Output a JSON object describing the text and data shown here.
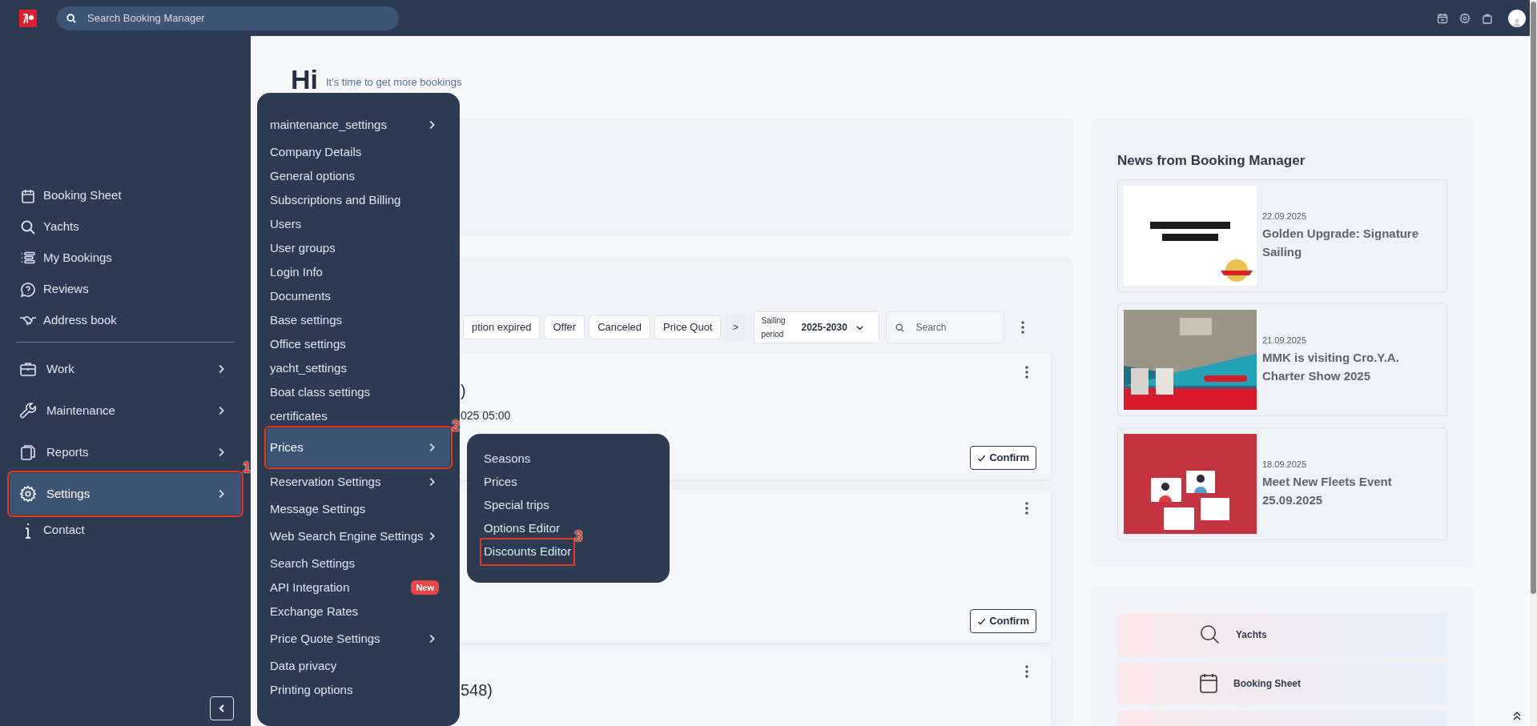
{
  "topbar": {
    "search_placeholder": "Search Booking Manager"
  },
  "sidebar": {
    "sections": [
      {
        "items": [
          {
            "label": "Booking Sheet",
            "has_submenu": false,
            "selected": false
          },
          {
            "label": "Yachts",
            "has_submenu": false,
            "selected": false
          },
          {
            "label": "My Bookings",
            "has_submenu": false,
            "selected": false
          },
          {
            "label": "Reviews",
            "has_submenu": false,
            "selected": false
          },
          {
            "label": "Address book",
            "has_submenu": false,
            "selected": false
          }
        ]
      },
      {
        "items": [
          {
            "label": "Work",
            "has_submenu": true,
            "selected": false
          },
          {
            "label": "Maintenance",
            "has_submenu": true,
            "selected": false
          },
          {
            "label": "Reports",
            "has_submenu": true,
            "selected": false
          },
          {
            "label": "Settings",
            "has_submenu": true,
            "selected": true,
            "annotation": "1"
          },
          {
            "label": "Contact",
            "has_submenu": false,
            "selected": false
          }
        ]
      }
    ]
  },
  "greeting": {
    "title": "Hi",
    "subtitle": "It's time to get more bookings"
  },
  "settings_menu": [
    {
      "label": "maintenance_settings",
      "has_submenu": true,
      "selected": false
    },
    {
      "label": "Company Details",
      "has_submenu": false,
      "selected": false
    },
    {
      "label": "General options",
      "has_submenu": false,
      "selected": false
    },
    {
      "label": "Subscriptions and Billing",
      "has_submenu": false,
      "selected": false
    },
    {
      "label": "Users",
      "has_submenu": false,
      "selected": false
    },
    {
      "label": "User groups",
      "has_submenu": false,
      "selected": false
    },
    {
      "label": "Login Info",
      "has_submenu": false,
      "selected": false
    },
    {
      "label": "Documents",
      "has_submenu": false,
      "selected": false
    },
    {
      "label": "Base settings",
      "has_submenu": false,
      "selected": false
    },
    {
      "label": "Office settings",
      "has_submenu": false,
      "selected": false
    },
    {
      "label": "yacht_settings",
      "has_submenu": false,
      "selected": false
    },
    {
      "label": "Boat class settings",
      "has_submenu": false,
      "selected": false
    },
    {
      "label": "certificates",
      "has_submenu": false,
      "selected": false
    },
    {
      "label": "Prices",
      "has_submenu": true,
      "selected": true,
      "annotation": "2"
    },
    {
      "label": "Reservation Settings",
      "has_submenu": true,
      "selected": false
    },
    {
      "label": "Message Settings",
      "has_submenu": false,
      "selected": false
    },
    {
      "label": "Web Search Engine Settings",
      "has_submenu": true,
      "selected": false
    },
    {
      "label": "Search Settings",
      "has_submenu": false,
      "selected": false
    },
    {
      "label": "API Integration",
      "has_submenu": false,
      "selected": false,
      "badge": "New"
    },
    {
      "label": "Exchange Rates",
      "has_submenu": false,
      "selected": false
    },
    {
      "label": "Price Quote Settings",
      "has_submenu": true,
      "selected": false
    },
    {
      "label": "Data privacy",
      "has_submenu": false,
      "selected": false
    },
    {
      "label": "Printing options",
      "has_submenu": false,
      "selected": false
    }
  ],
  "prices_submenu": [
    {
      "label": "Seasons"
    },
    {
      "label": "Prices"
    },
    {
      "label": "Special trips"
    },
    {
      "label": "Options Editor"
    },
    {
      "label": "Discounts Editor",
      "annotation": "3"
    }
  ],
  "bookings": {
    "filters": [
      "ption expired",
      "Offer",
      "Canceled",
      "Price Quot"
    ],
    "more_filters": ">",
    "sailing_period": {
      "label": "Sailing period",
      "value": "2025-2030"
    },
    "search_placeholder": "Search",
    "cards": [
      {
        "title": ")",
        "subtitle": "025 05:00",
        "button": "Confirm"
      },
      {
        "button": "Confirm"
      },
      {
        "title": "548)"
      }
    ]
  },
  "news": {
    "title": "News from Booking Manager",
    "items": [
      {
        "date": "22.09.2025",
        "title": "Golden Upgrade: Signature Sailing",
        "kind": "picture"
      },
      {
        "date": "21.09.2025",
        "title": "MMK is visiting Cro.Y.A. Charter Show 2025",
        "kind": "picture"
      },
      {
        "date": "18.09.2025",
        "title": "Meet New Fleets Event 25.09.2025",
        "kind": "picture"
      }
    ]
  },
  "quick_links": [
    "Yachts",
    "Booking Sheet"
  ]
}
